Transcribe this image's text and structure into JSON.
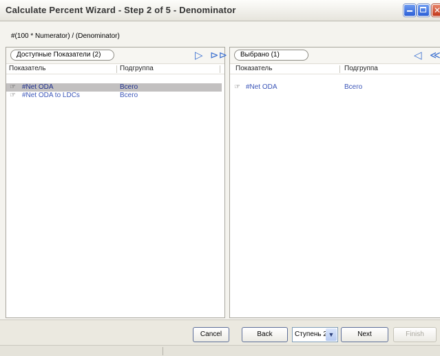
{
  "window": {
    "title": "Calculate Percent Wizard - Step 2 of 5 - Denominator",
    "buttons": [
      "minimize-icon",
      "maximize-icon",
      "close-icon"
    ]
  },
  "formula": "#(100 * Numerator) / (Denominator)",
  "available": {
    "header": "Доступные Показатели (2)",
    "col_indicator": "Показатель",
    "col_subgroup": "Подгруппа",
    "rows": [
      {
        "indicator": "#Net ODA",
        "subgroup": "Всего",
        "selected": true,
        "icon": "hand-pointer-icon"
      },
      {
        "indicator": "#Net ODA to LDCs",
        "subgroup": "Всего",
        "selected": false,
        "icon": "hand-pointer-icon"
      }
    ],
    "actions": [
      "move-right-icon",
      "move-all-right-icon"
    ]
  },
  "selected": {
    "header": "Выбрано (1)",
    "col_indicator": "Показатель",
    "col_subgroup": "Подгруппа",
    "rows": [
      {
        "indicator": "#Net ODA",
        "subgroup": "Всего",
        "icon": "hand-pointer-icon"
      }
    ],
    "actions": [
      "move-left-icon",
      "move-all-left-icon"
    ]
  },
  "footer": {
    "cancel": "Cancel",
    "back": "Back",
    "step_select": "Ступень 2",
    "next": "Next",
    "finish": "Finish",
    "finish_enabled": false
  },
  "colors": {
    "accent": "#3a6fd0",
    "selected_row": "#c2c0c0",
    "link_text": "#3b55b8"
  }
}
